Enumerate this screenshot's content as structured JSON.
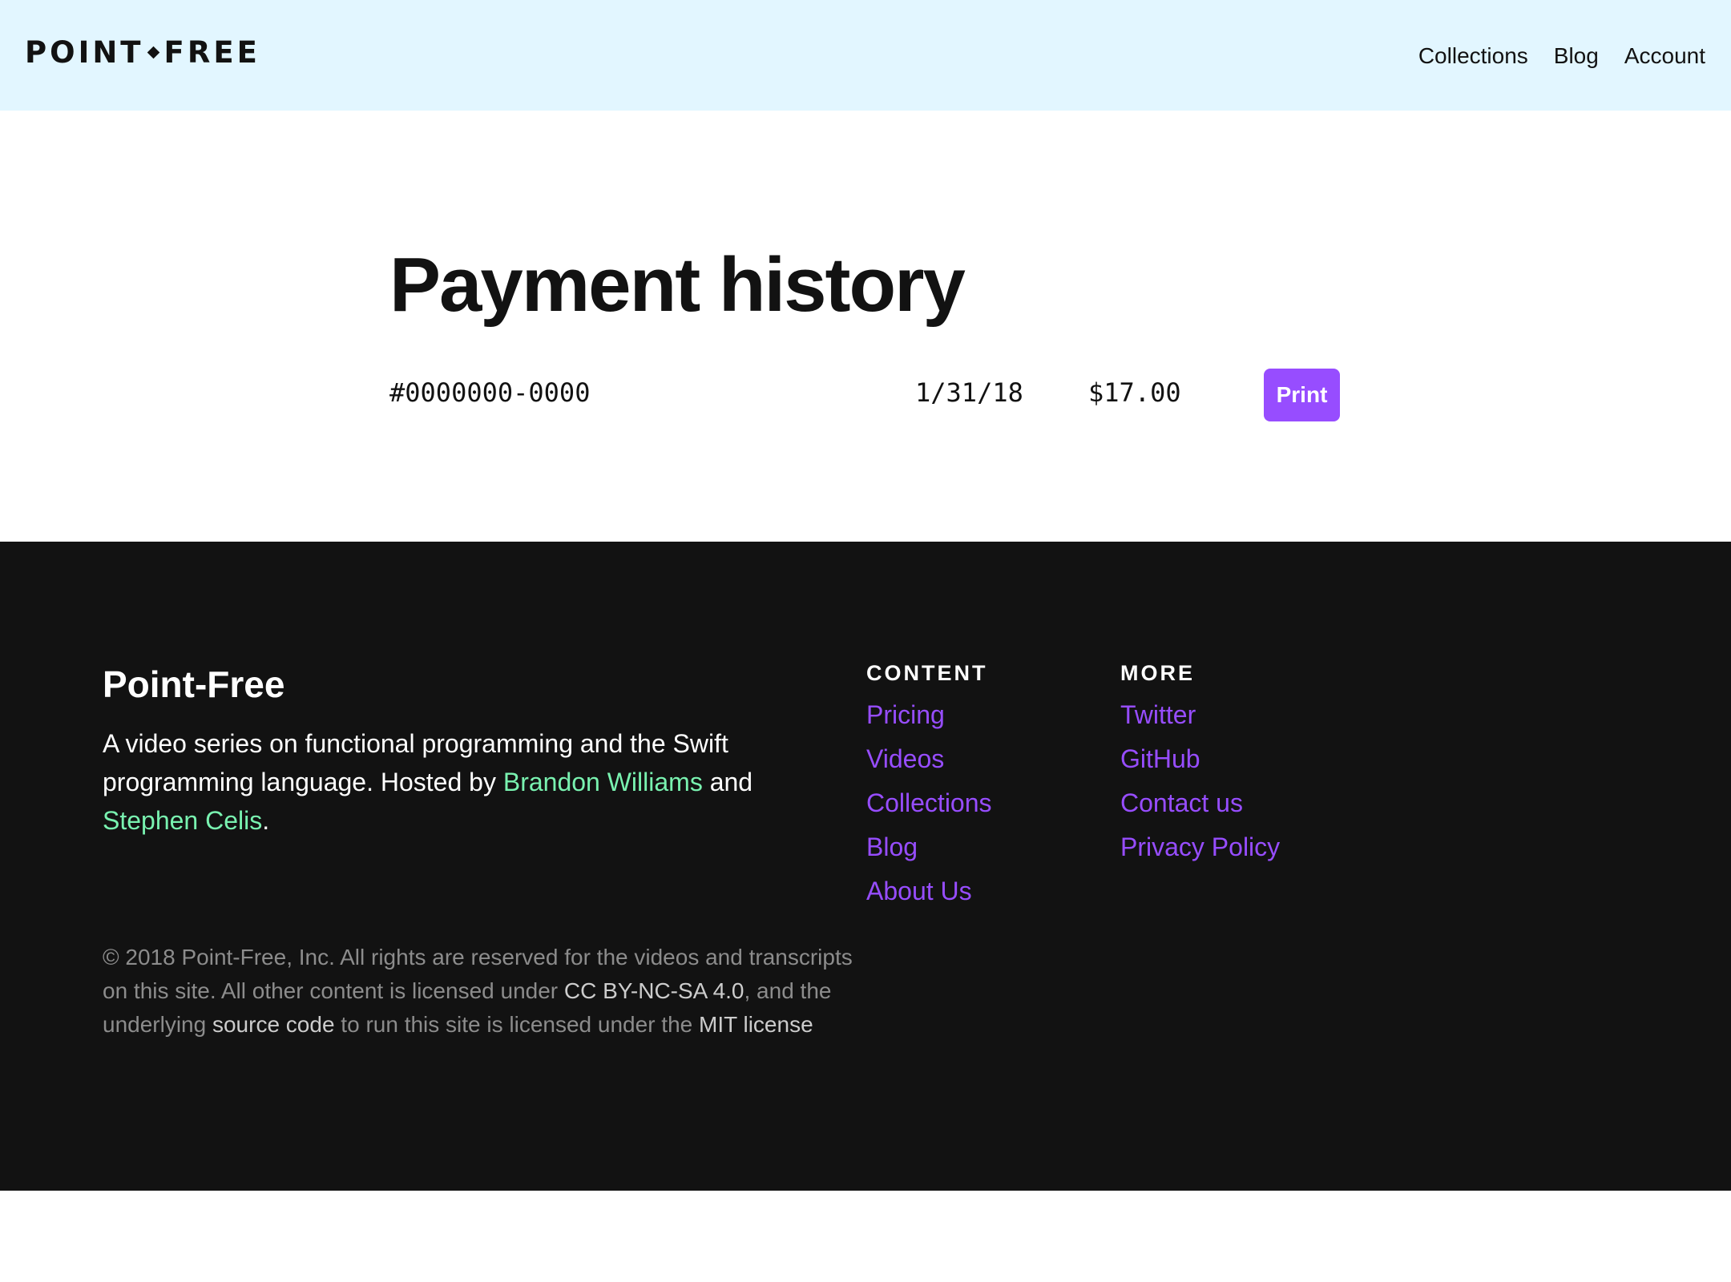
{
  "header": {
    "logo_left": "POINT",
    "logo_right": "FREE",
    "nav": [
      {
        "label": "Collections"
      },
      {
        "label": "Blog"
      },
      {
        "label": "Account"
      }
    ]
  },
  "main": {
    "title": "Payment history",
    "payment": {
      "invoice_id": "#0000000-0000",
      "date": "1/31/18",
      "amount": "$17.00",
      "print_label": "Print"
    }
  },
  "footer": {
    "brand_title": "Point-Free",
    "desc_part1": "A video series on functional programming and the Swift programming language. Hosted by ",
    "host1": "Brandon Williams",
    "desc_and": " and ",
    "host2": "Stephen Celis",
    "desc_end": ".",
    "content_heading": "CONTENT",
    "content_links": [
      {
        "label": "Pricing"
      },
      {
        "label": "Videos"
      },
      {
        "label": "Collections"
      },
      {
        "label": "Blog"
      },
      {
        "label": "About Us"
      }
    ],
    "more_heading": "MORE",
    "more_links": [
      {
        "label": "Twitter"
      },
      {
        "label": "GitHub"
      },
      {
        "label": "Contact us"
      },
      {
        "label": "Privacy Policy"
      }
    ],
    "legal_part1": "© 2018 Point-Free, Inc. All rights are reserved for the videos and transcripts on this site. All other content is licensed under ",
    "legal_cc": "CC BY-NC-SA 4.0",
    "legal_part2": ", and the underlying ",
    "legal_source": "source code",
    "legal_part3": " to run this site is licensed under the ",
    "legal_mit": "MIT license"
  },
  "colors": {
    "header_bg": "#e2f6ff",
    "footer_bg": "#121212",
    "accent_purple": "#974dff",
    "accent_green": "#79f2b0"
  }
}
